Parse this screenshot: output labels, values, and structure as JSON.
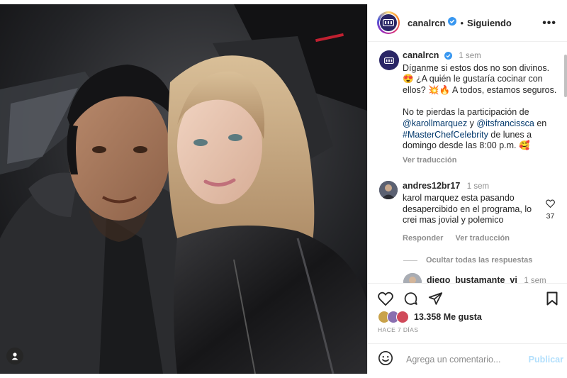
{
  "header": {
    "username": "canalrcn",
    "separator": "•",
    "follow_status": "Siguiendo",
    "more_icon": "more-horizontal-icon",
    "logo_text": "RCN"
  },
  "caption": {
    "username": "canalrcn",
    "time": "1 sem",
    "line1": "Díganme si estos dos no son divinos.",
    "line2": "😍 ¿A quién le gustaría cocinar con",
    "line3": "ellos? 💥🔥 A todos, estamos seguros.",
    "line4": "No te pierdas la participación de",
    "mention1": "@karollmarquez",
    "conj": " y ",
    "mention2": "@itsfrancissca",
    "line5_tail": " en",
    "hashtag": "#MasterChefCelebrity",
    "line6_tail": " de lunes a",
    "line7": "domingo desde las 8:00 p.m. 🥰",
    "see_translation": "Ver traducción"
  },
  "comments": [
    {
      "username": "andres12br17",
      "time": "1 sem",
      "line1": "karol marquez esta pasando",
      "line2": "desapercibido en el programa, lo",
      "line3": "crei mas jovial y polemico",
      "likes": "37",
      "reply": "Responder",
      "see_translation": "Ver traducción"
    }
  ],
  "hide_replies": "Ocultar todas las respuestas",
  "reply_preview": {
    "username": "diego_bustamante_vi",
    "time": "1 sem"
  },
  "likes": {
    "count_text": "13.358 Me gusta"
  },
  "posted_ago": "HACE 7 DÍAS",
  "comment_box": {
    "placeholder": "Agrega un comentario...",
    "publish": "Publicar"
  },
  "colors": {
    "verified": "#3897f0",
    "link": "#00376b",
    "muted": "#8e8e8e",
    "publish_disabled": "#b2dffc"
  }
}
